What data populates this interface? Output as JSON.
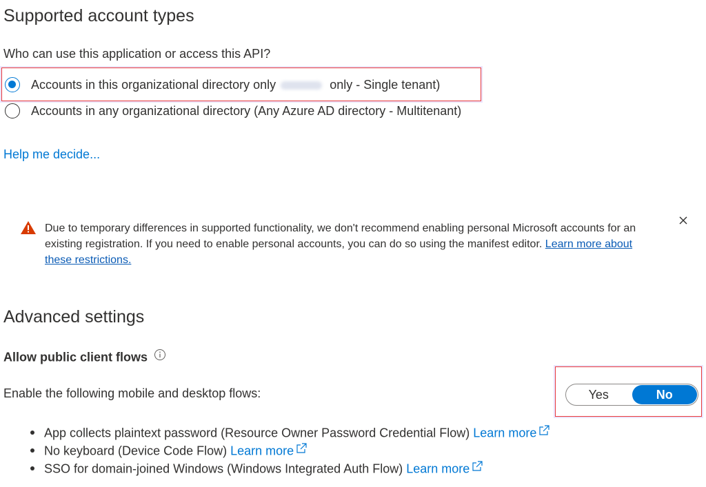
{
  "supported": {
    "title": "Supported account types",
    "question": "Who can use this application or access this API?",
    "options": [
      {
        "label_pre": "Accounts in this organizational directory only",
        "label_post": "only - Single tenant)",
        "selected": true
      },
      {
        "label": "Accounts in any organizational directory (Any Azure AD directory - Multitenant)",
        "selected": false
      }
    ],
    "help_link": "Help me decide..."
  },
  "warning": {
    "text": "Due to temporary differences in supported functionality, we don't recommend enabling personal Microsoft accounts for an existing registration. If you need to enable personal accounts, you can do so using the manifest editor.",
    "link": "Learn more about these restrictions."
  },
  "advanced": {
    "title": "Advanced settings",
    "public_flows_heading": "Allow public client flows",
    "enable_label": "Enable the following mobile and desktop flows:",
    "toggle": {
      "yes": "Yes",
      "no": "No",
      "selected": "No"
    },
    "flows": [
      {
        "text": "App collects plaintext password (Resource Owner Password Credential Flow)",
        "link": "Learn more"
      },
      {
        "text": "No keyboard (Device Code Flow)",
        "link": "Learn more"
      },
      {
        "text": "SSO for domain-joined Windows (Windows Integrated Auth Flow)",
        "link": "Learn more"
      }
    ]
  },
  "colors": {
    "accent": "#0078d4",
    "warning": "#d83b01",
    "highlight_border": "#e8393a"
  }
}
